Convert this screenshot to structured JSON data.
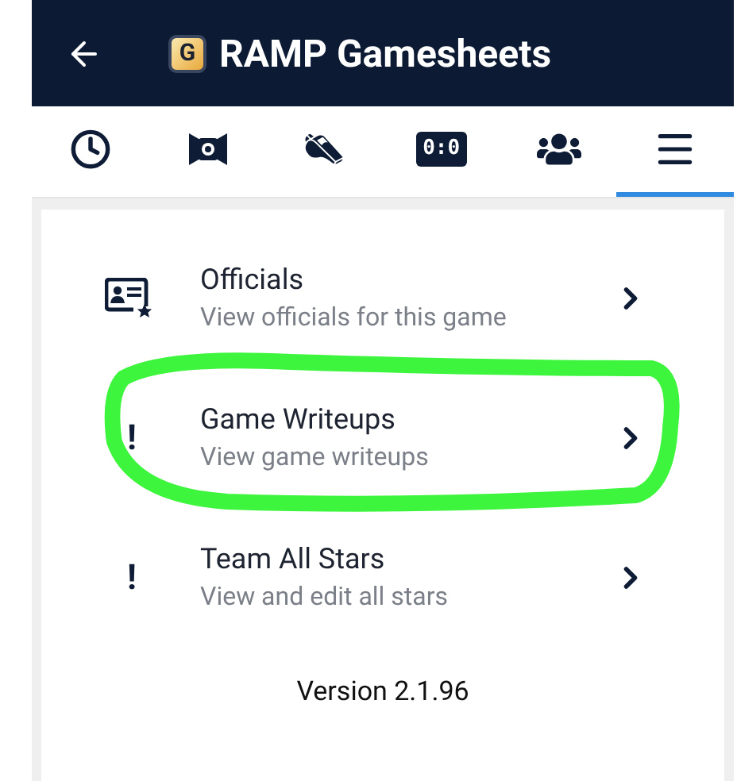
{
  "header": {
    "title": "RAMP Gamesheets",
    "logo_letter": "G"
  },
  "tabs": [
    {
      "kind": "clock",
      "selected": false
    },
    {
      "kind": "camera",
      "selected": false
    },
    {
      "kind": "whistle",
      "selected": false
    },
    {
      "kind": "score",
      "label": "0:0",
      "selected": false
    },
    {
      "kind": "people",
      "selected": false
    },
    {
      "kind": "menu",
      "selected": true
    }
  ],
  "menu_items": [
    {
      "kind": "id-card",
      "title": "Officials",
      "subtitle": "View officials for this game",
      "highlighted": false
    },
    {
      "kind": "glyph",
      "glyph": "!",
      "title": "Game Writeups",
      "subtitle": "View game writeups",
      "highlighted": true
    },
    {
      "kind": "glyph",
      "glyph": "!",
      "title": "Team All Stars",
      "subtitle": "View and edit all stars",
      "highlighted": false
    }
  ],
  "version": "Version 2.1.96"
}
